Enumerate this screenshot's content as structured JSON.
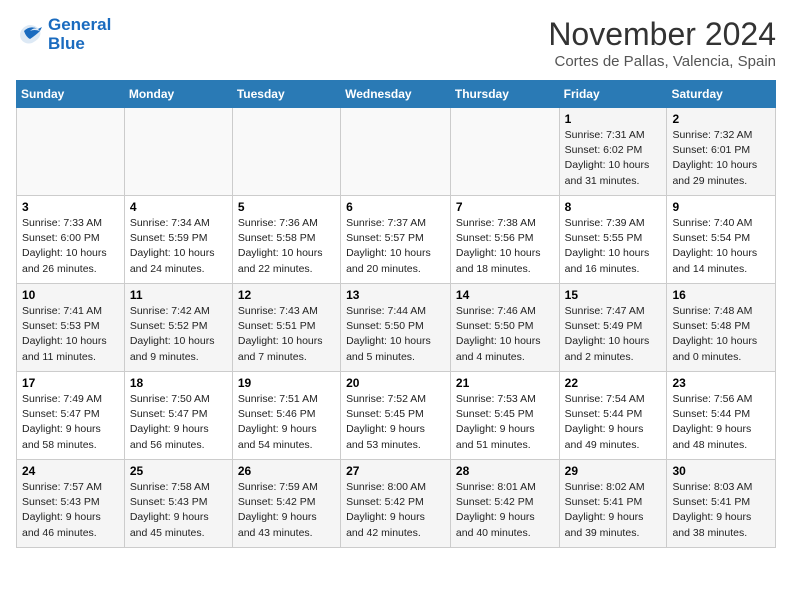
{
  "header": {
    "logo_line1": "General",
    "logo_line2": "Blue",
    "month": "November 2024",
    "location": "Cortes de Pallas, Valencia, Spain"
  },
  "weekdays": [
    "Sunday",
    "Monday",
    "Tuesday",
    "Wednesday",
    "Thursday",
    "Friday",
    "Saturday"
  ],
  "weeks": [
    [
      {
        "day": "",
        "info": ""
      },
      {
        "day": "",
        "info": ""
      },
      {
        "day": "",
        "info": ""
      },
      {
        "day": "",
        "info": ""
      },
      {
        "day": "",
        "info": ""
      },
      {
        "day": "1",
        "info": "Sunrise: 7:31 AM\nSunset: 6:02 PM\nDaylight: 10 hours and 31 minutes."
      },
      {
        "day": "2",
        "info": "Sunrise: 7:32 AM\nSunset: 6:01 PM\nDaylight: 10 hours and 29 minutes."
      }
    ],
    [
      {
        "day": "3",
        "info": "Sunrise: 7:33 AM\nSunset: 6:00 PM\nDaylight: 10 hours and 26 minutes."
      },
      {
        "day": "4",
        "info": "Sunrise: 7:34 AM\nSunset: 5:59 PM\nDaylight: 10 hours and 24 minutes."
      },
      {
        "day": "5",
        "info": "Sunrise: 7:36 AM\nSunset: 5:58 PM\nDaylight: 10 hours and 22 minutes."
      },
      {
        "day": "6",
        "info": "Sunrise: 7:37 AM\nSunset: 5:57 PM\nDaylight: 10 hours and 20 minutes."
      },
      {
        "day": "7",
        "info": "Sunrise: 7:38 AM\nSunset: 5:56 PM\nDaylight: 10 hours and 18 minutes."
      },
      {
        "day": "8",
        "info": "Sunrise: 7:39 AM\nSunset: 5:55 PM\nDaylight: 10 hours and 16 minutes."
      },
      {
        "day": "9",
        "info": "Sunrise: 7:40 AM\nSunset: 5:54 PM\nDaylight: 10 hours and 14 minutes."
      }
    ],
    [
      {
        "day": "10",
        "info": "Sunrise: 7:41 AM\nSunset: 5:53 PM\nDaylight: 10 hours and 11 minutes."
      },
      {
        "day": "11",
        "info": "Sunrise: 7:42 AM\nSunset: 5:52 PM\nDaylight: 10 hours and 9 minutes."
      },
      {
        "day": "12",
        "info": "Sunrise: 7:43 AM\nSunset: 5:51 PM\nDaylight: 10 hours and 7 minutes."
      },
      {
        "day": "13",
        "info": "Sunrise: 7:44 AM\nSunset: 5:50 PM\nDaylight: 10 hours and 5 minutes."
      },
      {
        "day": "14",
        "info": "Sunrise: 7:46 AM\nSunset: 5:50 PM\nDaylight: 10 hours and 4 minutes."
      },
      {
        "day": "15",
        "info": "Sunrise: 7:47 AM\nSunset: 5:49 PM\nDaylight: 10 hours and 2 minutes."
      },
      {
        "day": "16",
        "info": "Sunrise: 7:48 AM\nSunset: 5:48 PM\nDaylight: 10 hours and 0 minutes."
      }
    ],
    [
      {
        "day": "17",
        "info": "Sunrise: 7:49 AM\nSunset: 5:47 PM\nDaylight: 9 hours and 58 minutes."
      },
      {
        "day": "18",
        "info": "Sunrise: 7:50 AM\nSunset: 5:47 PM\nDaylight: 9 hours and 56 minutes."
      },
      {
        "day": "19",
        "info": "Sunrise: 7:51 AM\nSunset: 5:46 PM\nDaylight: 9 hours and 54 minutes."
      },
      {
        "day": "20",
        "info": "Sunrise: 7:52 AM\nSunset: 5:45 PM\nDaylight: 9 hours and 53 minutes."
      },
      {
        "day": "21",
        "info": "Sunrise: 7:53 AM\nSunset: 5:45 PM\nDaylight: 9 hours and 51 minutes."
      },
      {
        "day": "22",
        "info": "Sunrise: 7:54 AM\nSunset: 5:44 PM\nDaylight: 9 hours and 49 minutes."
      },
      {
        "day": "23",
        "info": "Sunrise: 7:56 AM\nSunset: 5:44 PM\nDaylight: 9 hours and 48 minutes."
      }
    ],
    [
      {
        "day": "24",
        "info": "Sunrise: 7:57 AM\nSunset: 5:43 PM\nDaylight: 9 hours and 46 minutes."
      },
      {
        "day": "25",
        "info": "Sunrise: 7:58 AM\nSunset: 5:43 PM\nDaylight: 9 hours and 45 minutes."
      },
      {
        "day": "26",
        "info": "Sunrise: 7:59 AM\nSunset: 5:42 PM\nDaylight: 9 hours and 43 minutes."
      },
      {
        "day": "27",
        "info": "Sunrise: 8:00 AM\nSunset: 5:42 PM\nDaylight: 9 hours and 42 minutes."
      },
      {
        "day": "28",
        "info": "Sunrise: 8:01 AM\nSunset: 5:42 PM\nDaylight: 9 hours and 40 minutes."
      },
      {
        "day": "29",
        "info": "Sunrise: 8:02 AM\nSunset: 5:41 PM\nDaylight: 9 hours and 39 minutes."
      },
      {
        "day": "30",
        "info": "Sunrise: 8:03 AM\nSunset: 5:41 PM\nDaylight: 9 hours and 38 minutes."
      }
    ]
  ]
}
